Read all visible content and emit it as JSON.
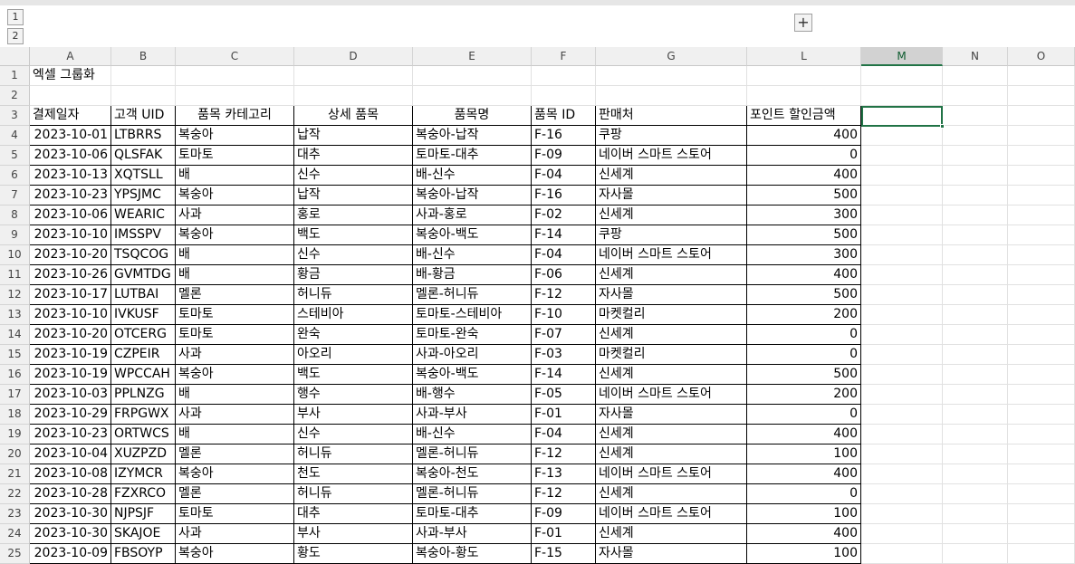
{
  "outline": {
    "levels": [
      "1",
      "2"
    ],
    "expand_symbol": "+"
  },
  "columns": [
    "A",
    "B",
    "C",
    "D",
    "E",
    "F",
    "G",
    "L",
    "M",
    "N",
    "O"
  ],
  "selected_column": "M",
  "title": "엑셀 그룹화",
  "headers": [
    "결제일자",
    "고객 UID",
    "품목 카테고리",
    "상세 품목",
    "품목명",
    "품목 ID",
    "판매처",
    "포인트 할인금액"
  ],
  "rows": [
    [
      "2023-10-01",
      "LTBRRS",
      "복숭아",
      "납작",
      "복숭아-납작",
      "F-16",
      "쿠팡",
      "400"
    ],
    [
      "2023-10-06",
      "QLSFAK",
      "토마토",
      "대추",
      "토마토-대추",
      "F-09",
      "네이버 스마트 스토어",
      "0"
    ],
    [
      "2023-10-13",
      "XQTSLL",
      "배",
      "신수",
      "배-신수",
      "F-04",
      "신세계",
      "400"
    ],
    [
      "2023-10-23",
      "YPSJMC",
      "복숭아",
      "납작",
      "복숭아-납작",
      "F-16",
      "자사몰",
      "500"
    ],
    [
      "2023-10-06",
      "WEARIC",
      "사과",
      "홍로",
      "사과-홍로",
      "F-02",
      "신세계",
      "300"
    ],
    [
      "2023-10-10",
      "IMSSPV",
      "복숭아",
      "백도",
      "복숭아-백도",
      "F-14",
      "쿠팡",
      "500"
    ],
    [
      "2023-10-20",
      "TSQCOG",
      "배",
      "신수",
      "배-신수",
      "F-04",
      "네이버 스마트 스토어",
      "300"
    ],
    [
      "2023-10-26",
      "GVMTDG",
      "배",
      "황금",
      "배-황금",
      "F-06",
      "신세계",
      "400"
    ],
    [
      "2023-10-17",
      "LUTBAI",
      "멜론",
      "허니듀",
      "멜론-허니듀",
      "F-12",
      "자사몰",
      "500"
    ],
    [
      "2023-10-10",
      "IVKUSF",
      "토마토",
      "스테비아",
      "토마토-스테비아",
      "F-10",
      "마켓컬리",
      "200"
    ],
    [
      "2023-10-20",
      "OTCERG",
      "토마토",
      "완숙",
      "토마토-완숙",
      "F-07",
      "신세계",
      "0"
    ],
    [
      "2023-10-19",
      "CZPEIR",
      "사과",
      "아오리",
      "사과-아오리",
      "F-03",
      "마켓컬리",
      "0"
    ],
    [
      "2023-10-19",
      "WPCCAH",
      "복숭아",
      "백도",
      "복숭아-백도",
      "F-14",
      "신세계",
      "500"
    ],
    [
      "2023-10-03",
      "PPLNZG",
      "배",
      "행수",
      "배-행수",
      "F-05",
      "네이버 스마트 스토어",
      "200"
    ],
    [
      "2023-10-29",
      "FRPGWX",
      "사과",
      "부사",
      "사과-부사",
      "F-01",
      "자사몰",
      "0"
    ],
    [
      "2023-10-23",
      "ORTWCS",
      "배",
      "신수",
      "배-신수",
      "F-04",
      "신세계",
      "400"
    ],
    [
      "2023-10-04",
      "XUZPZD",
      "멜론",
      "허니듀",
      "멜론-허니듀",
      "F-12",
      "신세계",
      "100"
    ],
    [
      "2023-10-08",
      "IZYMCR",
      "복숭아",
      "천도",
      "복숭아-천도",
      "F-13",
      "네이버 스마트 스토어",
      "400"
    ],
    [
      "2023-10-28",
      "FZXRCO",
      "멜론",
      "허니듀",
      "멜론-허니듀",
      "F-12",
      "신세계",
      "0"
    ],
    [
      "2023-10-30",
      "NJPSJF",
      "토마토",
      "대추",
      "토마토-대추",
      "F-09",
      "네이버 스마트 스토어",
      "100"
    ],
    [
      "2023-10-30",
      "SKAJOE",
      "사과",
      "부사",
      "사과-부사",
      "F-01",
      "신세계",
      "400"
    ],
    [
      "2023-10-09",
      "FBSOYP",
      "복숭아",
      "황도",
      "복숭아-황도",
      "F-15",
      "자사몰",
      "100"
    ]
  ]
}
